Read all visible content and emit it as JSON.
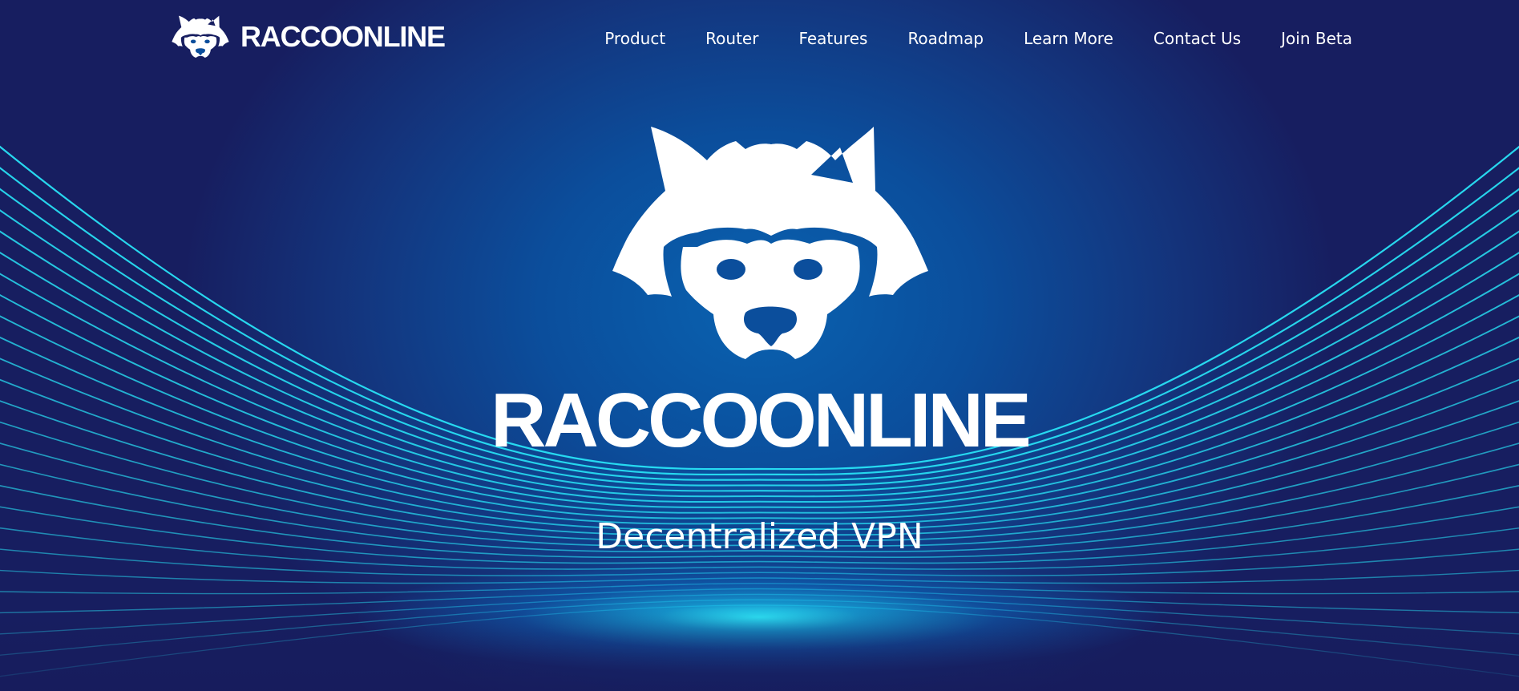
{
  "header": {
    "logo_icon": "raccoon-head-icon",
    "brand_name": "RACCOONLINE"
  },
  "nav": {
    "items": [
      {
        "label": "Product"
      },
      {
        "label": "Router"
      },
      {
        "label": "Features"
      },
      {
        "label": "Roadmap"
      },
      {
        "label": "Learn More"
      },
      {
        "label": "Contact Us"
      },
      {
        "label": "Join Beta"
      }
    ]
  },
  "hero": {
    "logo_icon": "raccoon-head-icon",
    "title": "RACCOONLINE",
    "subtitle": "Decentralized VPN"
  },
  "colors": {
    "background_dark": "#171c5c",
    "background_center": "#0962b0",
    "wave_line": "#28e2f5",
    "glow": "#2ef0ff",
    "text": "#ffffff"
  }
}
